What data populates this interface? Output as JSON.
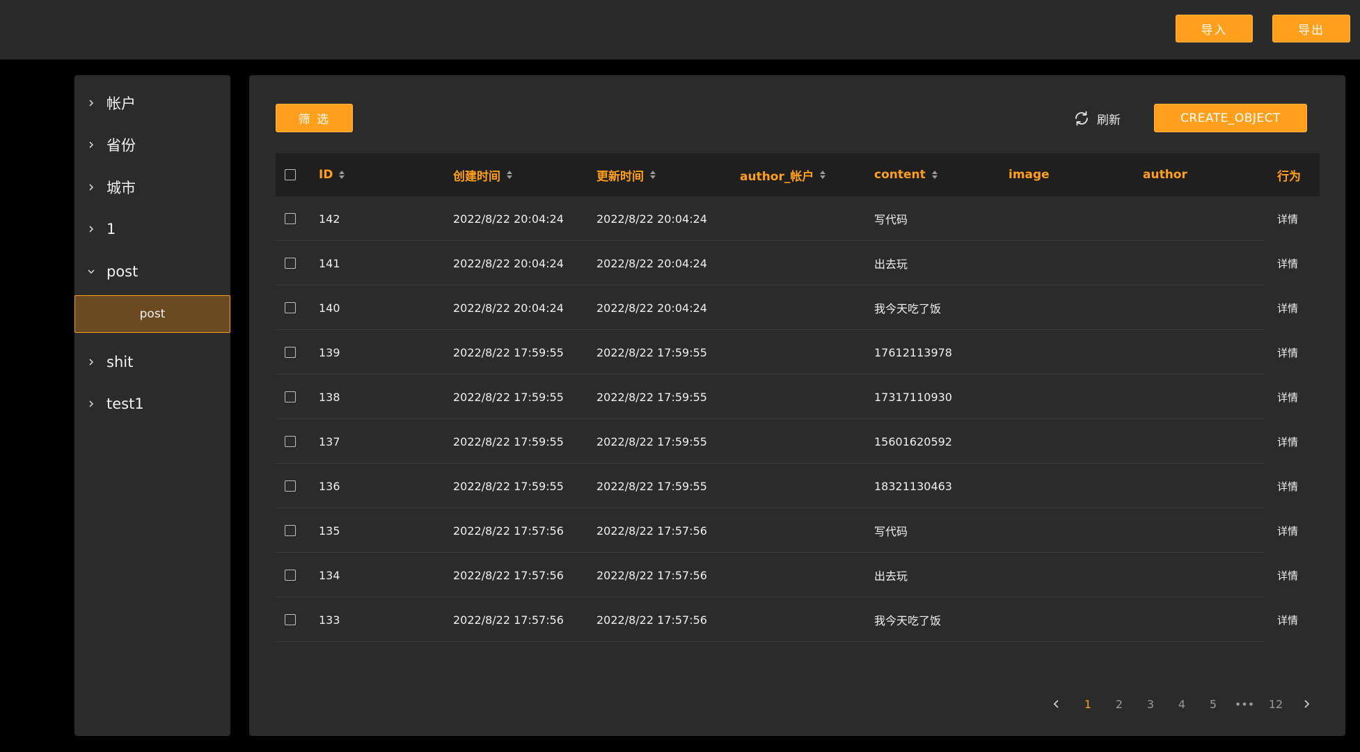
{
  "topbar": {
    "import_label": "导入",
    "export_label": "导出"
  },
  "sidebar": {
    "items": [
      {
        "label": "帐户",
        "expanded": false
      },
      {
        "label": "省份",
        "expanded": false
      },
      {
        "label": "城市",
        "expanded": false
      },
      {
        "label": "1",
        "expanded": false
      },
      {
        "label": "post",
        "expanded": true
      },
      {
        "label": "shit",
        "expanded": false
      },
      {
        "label": "test1",
        "expanded": false
      }
    ],
    "sub_item": "post"
  },
  "toolbar": {
    "filter_label": "筛 选",
    "refresh_label": "刷新",
    "create_label": "CREATE_OBJECT"
  },
  "table": {
    "columns": [
      "ID",
      "创建时间",
      "更新时间",
      "author_帐户",
      "content",
      "image",
      "author",
      "行为"
    ],
    "rows": [
      {
        "id": "142",
        "created": "2022/8/22 20:04:24",
        "updated": "2022/8/22 20:04:24",
        "content": "写代码",
        "action": "详情"
      },
      {
        "id": "141",
        "created": "2022/8/22 20:04:24",
        "updated": "2022/8/22 20:04:24",
        "content": "出去玩",
        "action": "详情"
      },
      {
        "id": "140",
        "created": "2022/8/22 20:04:24",
        "updated": "2022/8/22 20:04:24",
        "content": "我今天吃了饭",
        "action": "详情"
      },
      {
        "id": "139",
        "created": "2022/8/22 17:59:55",
        "updated": "2022/8/22 17:59:55",
        "content": "17612113978",
        "action": "详情"
      },
      {
        "id": "138",
        "created": "2022/8/22 17:59:55",
        "updated": "2022/8/22 17:59:55",
        "content": "17317110930",
        "action": "详情"
      },
      {
        "id": "137",
        "created": "2022/8/22 17:59:55",
        "updated": "2022/8/22 17:59:55",
        "content": "15601620592",
        "action": "详情"
      },
      {
        "id": "136",
        "created": "2022/8/22 17:59:55",
        "updated": "2022/8/22 17:59:55",
        "content": "18321130463",
        "action": "详情"
      },
      {
        "id": "135",
        "created": "2022/8/22 17:57:56",
        "updated": "2022/8/22 17:57:56",
        "content": "写代码",
        "action": "详情"
      },
      {
        "id": "134",
        "created": "2022/8/22 17:57:56",
        "updated": "2022/8/22 17:57:56",
        "content": "出去玩",
        "action": "详情"
      },
      {
        "id": "133",
        "created": "2022/8/22 17:57:56",
        "updated": "2022/8/22 17:57:56",
        "content": "我今天吃了饭",
        "action": "详情"
      }
    ]
  },
  "pagination": {
    "pages": [
      "1",
      "2",
      "3",
      "4",
      "5",
      "•••",
      "12"
    ],
    "current": "1"
  },
  "colors": {
    "accent": "#ff9f1c",
    "panel": "#2b2b2b",
    "background": "#000000"
  }
}
